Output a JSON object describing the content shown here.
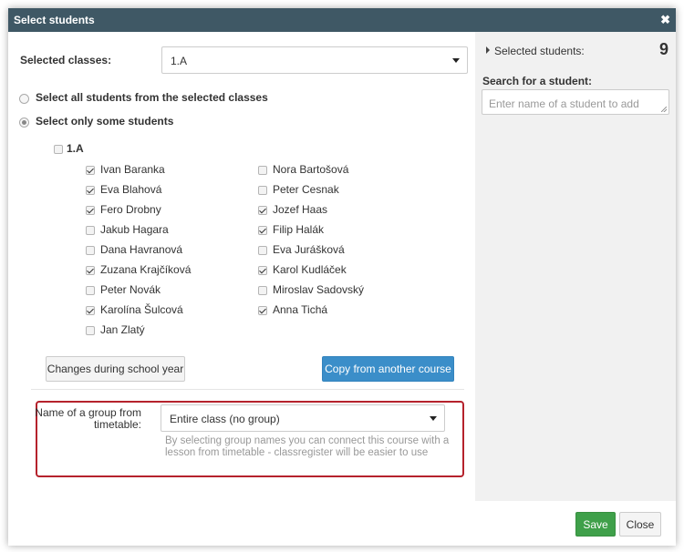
{
  "dialog": {
    "title": "Select students",
    "close_glyph": "✖"
  },
  "classes": {
    "label": "Selected classes:",
    "value": "1.A"
  },
  "selection_mode": {
    "all_label": "Select all students from the selected classes",
    "some_label": "Select only some students"
  },
  "class_group": {
    "name": "1.A"
  },
  "students_left": [
    {
      "name": "Ivan Baranka",
      "checked": true
    },
    {
      "name": "Eva Blahová",
      "checked": true
    },
    {
      "name": "Fero Drobny",
      "checked": true
    },
    {
      "name": "Jakub Hagara",
      "checked": false
    },
    {
      "name": "Dana Havranová",
      "checked": false
    },
    {
      "name": "Zuzana Krajčíková",
      "checked": true
    },
    {
      "name": "Peter Novák",
      "checked": false
    },
    {
      "name": "Karolína Šulcová",
      "checked": true
    },
    {
      "name": "Jan Zlatý",
      "checked": false
    }
  ],
  "students_right": [
    {
      "name": "Nora Bartošová",
      "checked": false
    },
    {
      "name": "Peter Cesnak",
      "checked": false
    },
    {
      "name": "Jozef Haas",
      "checked": true
    },
    {
      "name": "Filip Halák",
      "checked": true
    },
    {
      "name": "Eva Jurášková",
      "checked": false
    },
    {
      "name": "Karol Kudláček",
      "checked": true
    },
    {
      "name": "Miroslav Sadovský",
      "checked": false
    },
    {
      "name": "Anna Tichá",
      "checked": true
    }
  ],
  "buttons": {
    "changes": "Changes during school year",
    "copy": "Copy from another course",
    "save": "Save",
    "close": "Close"
  },
  "group": {
    "label_line1": "Name of a group from",
    "label_line2": "timetable:",
    "value": "Entire class (no group)",
    "help_line1": "By selecting group names you can connect this course with a",
    "help_line2": "lesson from timetable - classregister will be easier to use"
  },
  "sidebar": {
    "selected_label": "Selected students:",
    "selected_count": "9",
    "search_label": "Search for a student:",
    "search_placeholder": "Enter name of a student to add"
  }
}
